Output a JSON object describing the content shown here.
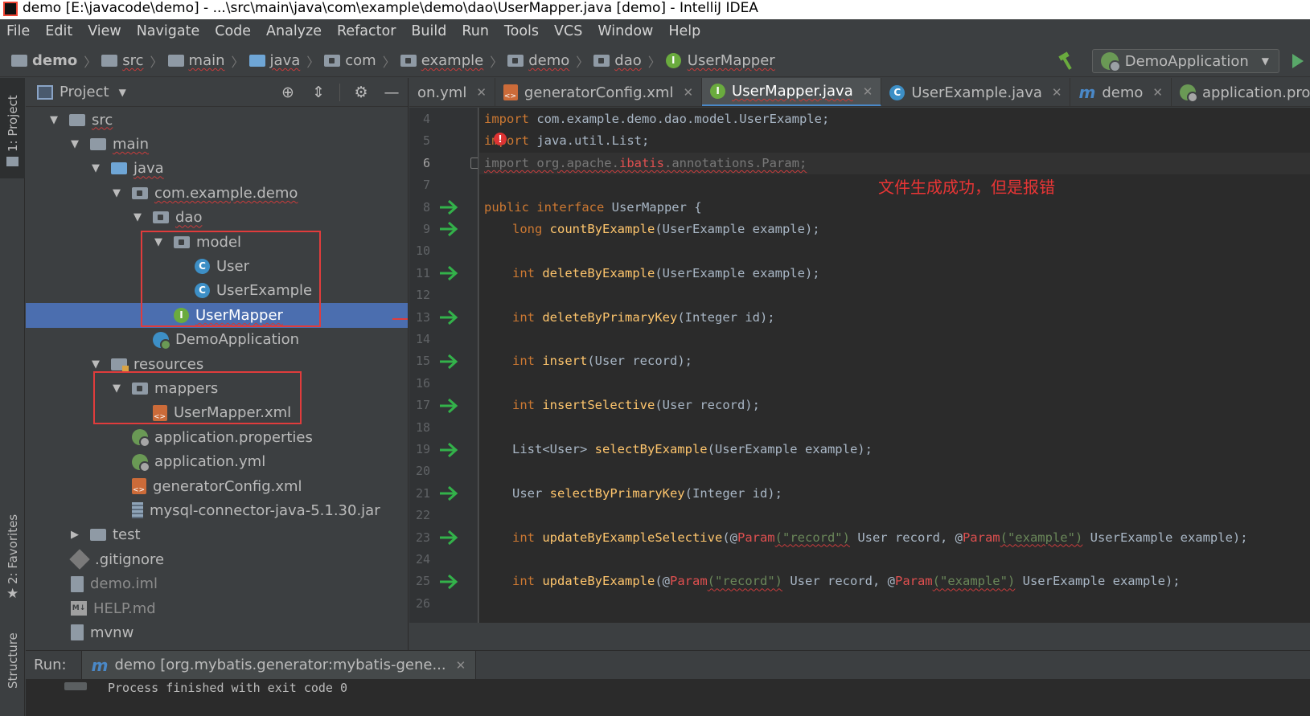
{
  "window": {
    "title": "demo [E:\\javacode\\demo] - ...\\src\\main\\java\\com\\example\\demo\\dao\\UserMapper.java [demo] - IntelliJ IDEA"
  },
  "menu": [
    "File",
    "Edit",
    "View",
    "Navigate",
    "Code",
    "Analyze",
    "Refactor",
    "Build",
    "Run",
    "Tools",
    "VCS",
    "Window",
    "Help"
  ],
  "breadcrumb": [
    "demo",
    "src",
    "main",
    "java",
    "com",
    "example",
    "demo",
    "dao",
    "UserMapper"
  ],
  "run_config": {
    "label": "DemoApplication"
  },
  "left_strip": {
    "project": "1: Project",
    "favorites": "2: Favorites",
    "structure": "Structure"
  },
  "project_panel": {
    "title": "Project",
    "tree": [
      {
        "label": "src"
      },
      {
        "label": "main"
      },
      {
        "label": "java"
      },
      {
        "label": "com.example.demo"
      },
      {
        "label": "dao"
      },
      {
        "label": "model"
      },
      {
        "label": "User"
      },
      {
        "label": "UserExample"
      },
      {
        "label": "UserMapper"
      },
      {
        "label": "DemoApplication"
      },
      {
        "label": "resources"
      },
      {
        "label": "mappers"
      },
      {
        "label": "UserMapper.xml"
      },
      {
        "label": "application.properties"
      },
      {
        "label": "application.yml"
      },
      {
        "label": "generatorConfig.xml"
      },
      {
        "label": "mysql-connector-java-5.1.30.jar"
      },
      {
        "label": "test"
      },
      {
        "label": ".gitignore"
      },
      {
        "label": "demo.iml"
      },
      {
        "label": "HELP.md"
      },
      {
        "label": "mvnw"
      }
    ]
  },
  "editor": {
    "tabs": [
      "on.yml",
      "generatorConfig.xml",
      "UserMapper.java",
      "UserExample.java",
      "demo",
      "application.prope"
    ],
    "active_tab": "UserMapper.java",
    "line_numbers": [
      "4",
      "5",
      "6",
      "7",
      "8",
      "9",
      "10",
      "11",
      "12",
      "13",
      "14",
      "15",
      "16",
      "17",
      "18",
      "19",
      "20",
      "21",
      "22",
      "23",
      "24",
      "25",
      "26"
    ],
    "annotation": "文件生成成功，但是报错",
    "code": {
      "l4_kw": "import",
      "l4_rest": " com.example.demo.dao.model.UserExample;",
      "l5_kw": "import",
      "l5_rest": " java.util.List;",
      "l6_a": "import org.apache.",
      "l6_b": "ibatis",
      "l6_c": ".annotations.Param;",
      "l8_kw": "public interface",
      "l8_rest": " UserMapper {",
      "l9_kw": "long",
      "l9_fn": "countByExample",
      "l9_rest": "(UserExample example);",
      "l11_kw": "int",
      "l11_fn": "deleteByExample",
      "l11_rest": "(UserExample example);",
      "l13_kw": "int",
      "l13_fn": "deleteByPrimaryKey",
      "l13_rest": "(Integer id);",
      "l15_kw": "int",
      "l15_fn": "insert",
      "l15_rest": "(User record);",
      "l17_kw": "int",
      "l17_fn": "insertSelective",
      "l17_rest": "(User record);",
      "l19_pre": "List<User> ",
      "l19_fn": "selectByExample",
      "l19_rest": "(UserExample example);",
      "l21_pre": "User ",
      "l21_fn": "selectByPrimaryKey",
      "l21_rest": "(Integer id);",
      "l23_kw": "int",
      "l23_fn": "updateByExampleSelective",
      "l23_p1": "(@",
      "l23_param1": "Param",
      "l23_s1": "(\"record\")",
      "l23_mid": " User record, @",
      "l23_param2": "Param",
      "l23_s2": "(\"example\")",
      "l23_end": " UserExample example);",
      "l25_kw": "int",
      "l25_fn": "updateByExample",
      "l25_p1": "(@",
      "l25_param1": "Param",
      "l25_s1": "(\"record\")",
      "l25_mid": " User record, @",
      "l25_param2": "Param",
      "l25_s2": "(\"example\")",
      "l25_end": " UserExample example);"
    }
  },
  "run_panel": {
    "label": "Run:",
    "tab": "demo [org.mybatis.generator:mybatis-gene...",
    "output": "Process finished with exit code 0"
  }
}
